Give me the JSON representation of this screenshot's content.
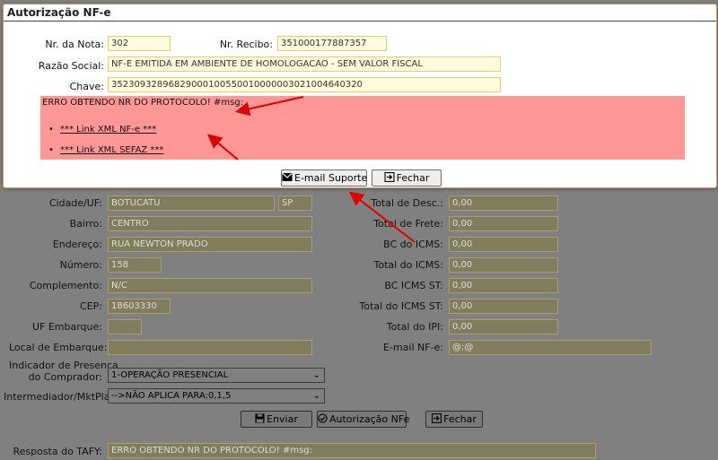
{
  "top_strip_text": "",
  "background_form": {
    "left": [
      {
        "label": "Cidade/UF:",
        "value": "BOTUCATU",
        "extra": "SP"
      },
      {
        "label": "Bairro:",
        "value": "CENTRO"
      },
      {
        "label": "Endereço:",
        "value": "RUA NEWTON PRADO"
      },
      {
        "label": "Número:",
        "value": "158"
      },
      {
        "label": "Complemento:",
        "value": "N/C"
      },
      {
        "label": "CEP:",
        "value": "18603330"
      },
      {
        "label": "UF Embarque:",
        "value": ""
      },
      {
        "label": "Local de Embarque:",
        "value": ""
      }
    ],
    "right": [
      {
        "label": "Total de Desc.:",
        "value": "0,00"
      },
      {
        "label": "Total de Frete:",
        "value": "0,00"
      },
      {
        "label": "BC do ICMS:",
        "value": "0,00"
      },
      {
        "label": "Total do ICMS:",
        "value": "0,00"
      },
      {
        "label": "BC ICMS ST:",
        "value": "0,00"
      },
      {
        "label": "Total do ICMS ST:",
        "value": "0,00"
      },
      {
        "label": "Total do IPI:",
        "value": "0,00"
      },
      {
        "label": "E-mail NF-e:",
        "value": "@;@"
      }
    ],
    "presence_label_1": "Indicador de Presença",
    "presence_label_2": "do Comprador:",
    "presence_value": "1-OPERAÇÃO PRESENCIAL",
    "intermediary_label": "Intermediador/MktPlace:",
    "intermediary_value": "-->NÃO APLICA PARA:0,1,5",
    "buttons": {
      "send": "Enviar",
      "authorization": "Autorização NFe",
      "close": "Fechar"
    },
    "response_label": "Resposta do TAFY:",
    "response_value": "ERRO OBTENDO NR DO PROTOCOLO! #msg:"
  },
  "dialog": {
    "title": "Autorização NF-e",
    "note_number_label": "Nr. da Nota:",
    "note_number": "302",
    "receipt_label": "Nr. Recibo:",
    "receipt": "351000177887357",
    "company_label": "Razão Social:",
    "company": "NF-E EMITIDA EM AMBIENTE DE HOMOLOGACAO - SEM VALOR FISCAL",
    "key_label": "Chave:",
    "key": "35230932896829000100550010000003021004640320",
    "error_message": "ERRO OBTENDO NR DO PROTOCOLO! #msg:",
    "links": [
      "*** Link XML NF-e ***",
      "*** Link XML SEFAZ ***"
    ],
    "email_button": "E-mail Suporte",
    "close_button": "Fechar"
  },
  "colors": {
    "error_background": "#ff9797",
    "field_background": "#fffbdc",
    "arrow": "#e00000",
    "overlay": "#808080"
  }
}
